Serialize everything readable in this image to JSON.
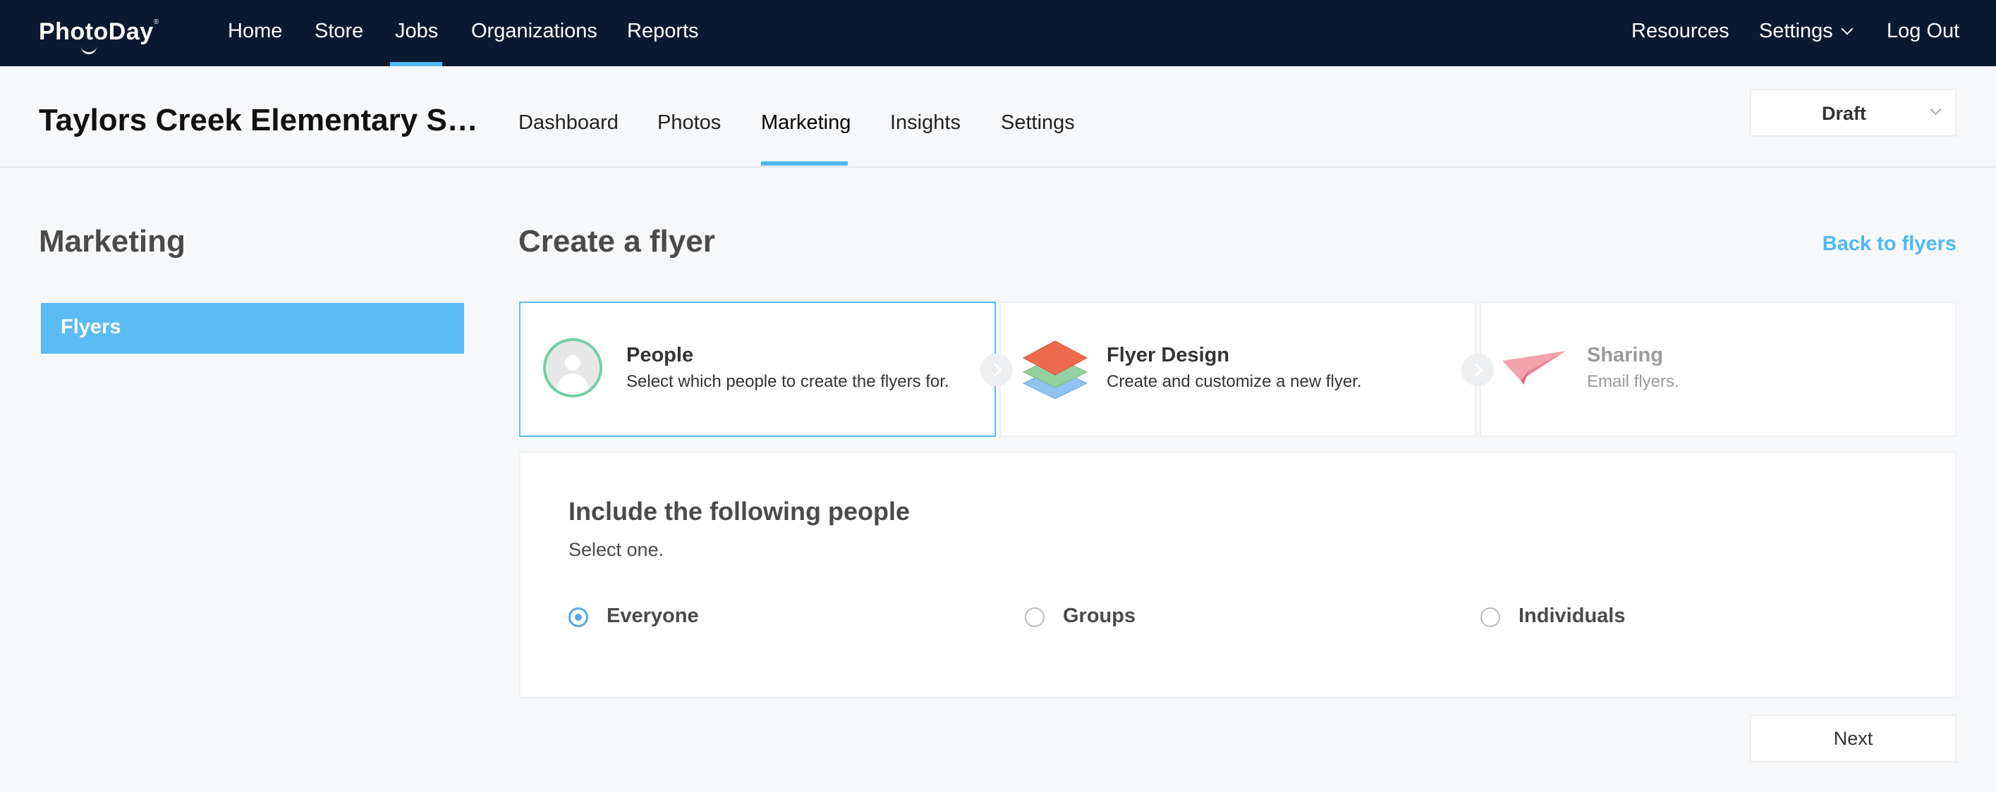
{
  "topnav": {
    "logo": "PhotoDay",
    "logo_mark": "®",
    "items": [
      "Home",
      "Store",
      "Jobs",
      "Organizations",
      "Reports"
    ],
    "active_item": "Jobs",
    "right_items": {
      "resources": "Resources",
      "settings": "Settings",
      "logout": "Log Out"
    }
  },
  "job": {
    "title": "Taylors Creek Elementary S…",
    "tabs": [
      "Dashboard",
      "Photos",
      "Marketing",
      "Insights",
      "Settings"
    ],
    "active_tab": "Marketing",
    "status": "Draft"
  },
  "sidebar": {
    "title": "Marketing",
    "items": [
      {
        "label": "Flyers",
        "active": true
      }
    ]
  },
  "main": {
    "title": "Create a flyer",
    "back_link": "Back to flyers",
    "steps": [
      {
        "title": "People",
        "desc": "Select which people to create the flyers for.",
        "icon": "person-avatar-icon",
        "active": true
      },
      {
        "title": "Flyer Design",
        "desc": "Create and customize a new flyer.",
        "icon": "layers-icon",
        "active": false
      },
      {
        "title": "Sharing",
        "desc": "Email flyers.",
        "icon": "paper-plane-icon",
        "active": false,
        "disabled": true
      }
    ]
  },
  "people_card": {
    "title": "Include the following people",
    "subtitle": "Select one.",
    "options": [
      {
        "label": "Everyone",
        "selected": true
      },
      {
        "label": "Groups",
        "selected": false
      },
      {
        "label": "Individuals",
        "selected": false
      }
    ]
  },
  "footer": {
    "next_label": "Next"
  },
  "colors": {
    "navbar": "#091a30",
    "accent": "#4fb9f0",
    "sidebar_active": "#5bbcf4",
    "radio": "#5aa6f0"
  }
}
